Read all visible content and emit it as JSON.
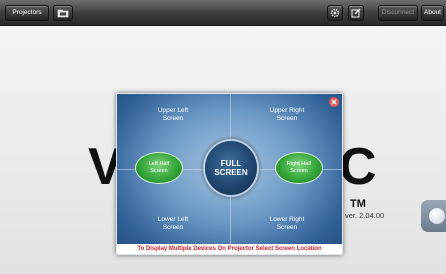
{
  "toolbar": {
    "projectors_label": "Projectors",
    "folder_icon": "folder-icon",
    "gear_icon": "gear-icon",
    "edit_icon": "edit-icon",
    "disconnect_label": "Disconnect",
    "about_label": "About"
  },
  "background": {
    "logo_left": "V",
    "logo_right": "C",
    "tm": "TM",
    "version": "ver. 2.04.00"
  },
  "dialog": {
    "upper_left": "Upper Left\nScreen",
    "upper_right": "Upper Right\nScreen",
    "lower_left": "Lower Left\nScreen",
    "lower_right": "Lower Right\nScreen",
    "left_half": "Left Half\nScreen",
    "right_half": "Right Half\nScreen",
    "full_screen": "FULL\nSCREEN",
    "footer": "To Display Multiple Devices On Projector Select Screen Location",
    "close_icon": "close-icon"
  },
  "colors": {
    "footer_text": "#d41f1f",
    "half_button": "#35a53a",
    "dialog_blue": "#2e5f95"
  }
}
